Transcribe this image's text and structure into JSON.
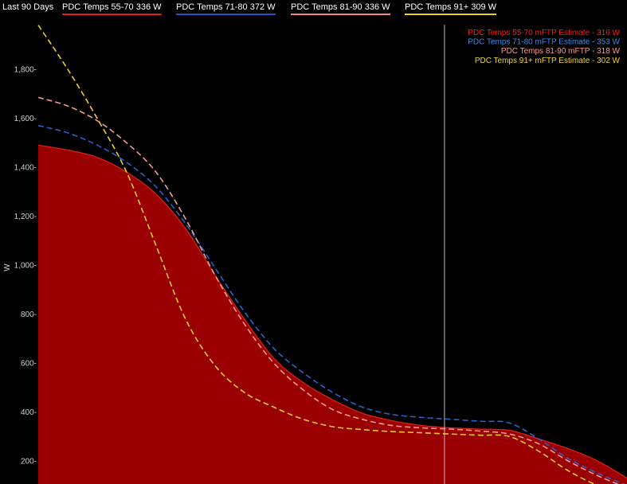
{
  "header": {
    "range_label": "Last 90 Days",
    "legend": [
      {
        "label": "PDC Temps 55-70  336 W",
        "color": "#e3201b"
      },
      {
        "label": "PDC Temps 71-80  372 W",
        "color": "#2255c8"
      },
      {
        "label": "PDC Temps 81-90  336 W",
        "color": "#f08a80"
      },
      {
        "label": "PDC Temps 91+  309 W",
        "color": "#e8cf2a"
      }
    ]
  },
  "chart_data": {
    "type": "area",
    "ylabel": "W",
    "ylim": [
      100,
      1960
    ],
    "yticks": [
      {
        "value": 200,
        "label": "200-"
      },
      {
        "value": 400,
        "label": "400-"
      },
      {
        "value": 600,
        "label": "600-"
      },
      {
        "value": 800,
        "label": "800-"
      },
      {
        "value": 1000,
        "label": "1,000-"
      },
      {
        "value": 1200,
        "label": "1,200-"
      },
      {
        "value": 1400,
        "label": "1,400-"
      },
      {
        "value": 1600,
        "label": "1,600-"
      },
      {
        "value": 1800,
        "label": "1,800-"
      }
    ],
    "x": [
      0,
      0.05,
      0.1,
      0.15,
      0.2,
      0.25,
      0.3,
      0.35,
      0.4,
      0.45,
      0.5,
      0.55,
      0.6,
      0.65,
      0.7,
      0.75,
      0.8,
      0.85,
      0.9,
      0.95,
      1
    ],
    "marker_x": 0.69,
    "series": [
      {
        "name": "PDC Temps 55-70",
        "color": "#e3201b",
        "fill": "#9a0000",
        "style": "area",
        "values": [
          1490,
          1470,
          1440,
          1380,
          1290,
          1150,
          960,
          780,
          620,
          520,
          450,
          395,
          365,
          345,
          335,
          330,
          325,
          290,
          250,
          200,
          130
        ]
      },
      {
        "name": "PDC Temps 71-80",
        "color": "#2a5fd0",
        "style": "dash",
        "values": [
          1570,
          1540,
          1490,
          1420,
          1320,
          1170,
          990,
          810,
          660,
          560,
          480,
          420,
          390,
          378,
          370,
          362,
          355,
          290,
          210,
          150,
          100
        ]
      },
      {
        "name": "PDC Temps 81-90",
        "color": "#f49a90",
        "style": "dash",
        "values": [
          1685,
          1650,
          1590,
          1500,
          1380,
          1190,
          960,
          760,
          600,
          490,
          410,
          370,
          345,
          335,
          330,
          322,
          310,
          270,
          200,
          140,
          90
        ]
      },
      {
        "name": "PDC Temps 91+",
        "color": "#e8cf2a",
        "style": "dash",
        "values": [
          1980,
          1800,
          1600,
          1380,
          1080,
          780,
          590,
          480,
          420,
          370,
          340,
          328,
          320,
          315,
          310,
          305,
          300,
          240,
          160,
          100,
          60
        ]
      }
    ],
    "estimates": [
      {
        "label": "PDC Temps 55-70 mFTP Estimate - 316 W",
        "color": "#ff1a1a"
      },
      {
        "label": "PDC Temps 71-80 mFTP Estimate - 353 W",
        "color": "#3f8ae0"
      },
      {
        "label": "PDC Temps 81-90 mFTP - 318 W",
        "color": "#f49a90"
      },
      {
        "label": "PDC Temps 91+ mFTP Estimate - 302 W",
        "color": "#f0d52e"
      }
    ]
  }
}
